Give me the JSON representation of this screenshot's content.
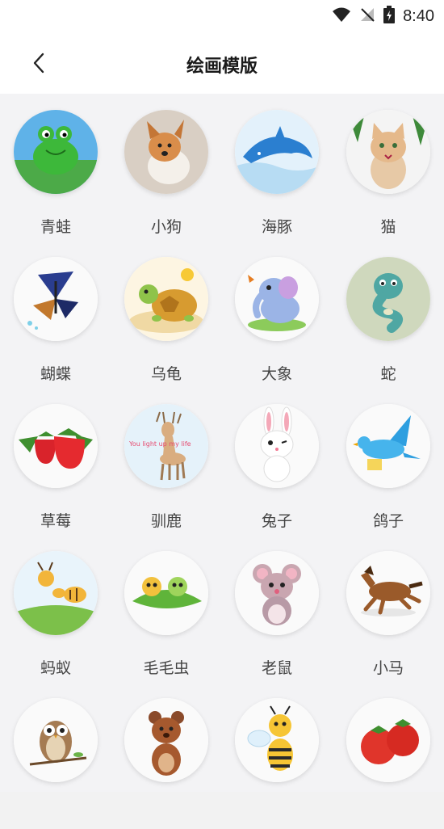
{
  "status_bar": {
    "time": "8:40",
    "icons": [
      "wifi-icon",
      "no-signal-icon",
      "battery-charging-icon"
    ]
  },
  "header": {
    "back_icon": "chevron-left-icon",
    "title": "绘画模版"
  },
  "templates": [
    {
      "label": "青蛙",
      "icon": "frog"
    },
    {
      "label": "小狗",
      "icon": "puppy"
    },
    {
      "label": "海豚",
      "icon": "dolphin"
    },
    {
      "label": "猫",
      "icon": "cat"
    },
    {
      "label": "蝴蝶",
      "icon": "butterfly"
    },
    {
      "label": "乌龟",
      "icon": "turtle"
    },
    {
      "label": "大象",
      "icon": "elephant"
    },
    {
      "label": "蛇",
      "icon": "snake"
    },
    {
      "label": "草莓",
      "icon": "strawberry"
    },
    {
      "label": "驯鹿",
      "icon": "deer",
      "image_text": "You light up my life"
    },
    {
      "label": "兔子",
      "icon": "rabbit"
    },
    {
      "label": "鸽子",
      "icon": "pigeon"
    },
    {
      "label": "蚂蚁",
      "icon": "ant"
    },
    {
      "label": "毛毛虫",
      "icon": "caterpillar"
    },
    {
      "label": "老鼠",
      "icon": "mouse"
    },
    {
      "label": "小马",
      "icon": "horse"
    },
    {
      "label": "",
      "icon": "owl"
    },
    {
      "label": "",
      "icon": "bear"
    },
    {
      "label": "",
      "icon": "bee"
    },
    {
      "label": "",
      "icon": "tomato"
    }
  ]
}
